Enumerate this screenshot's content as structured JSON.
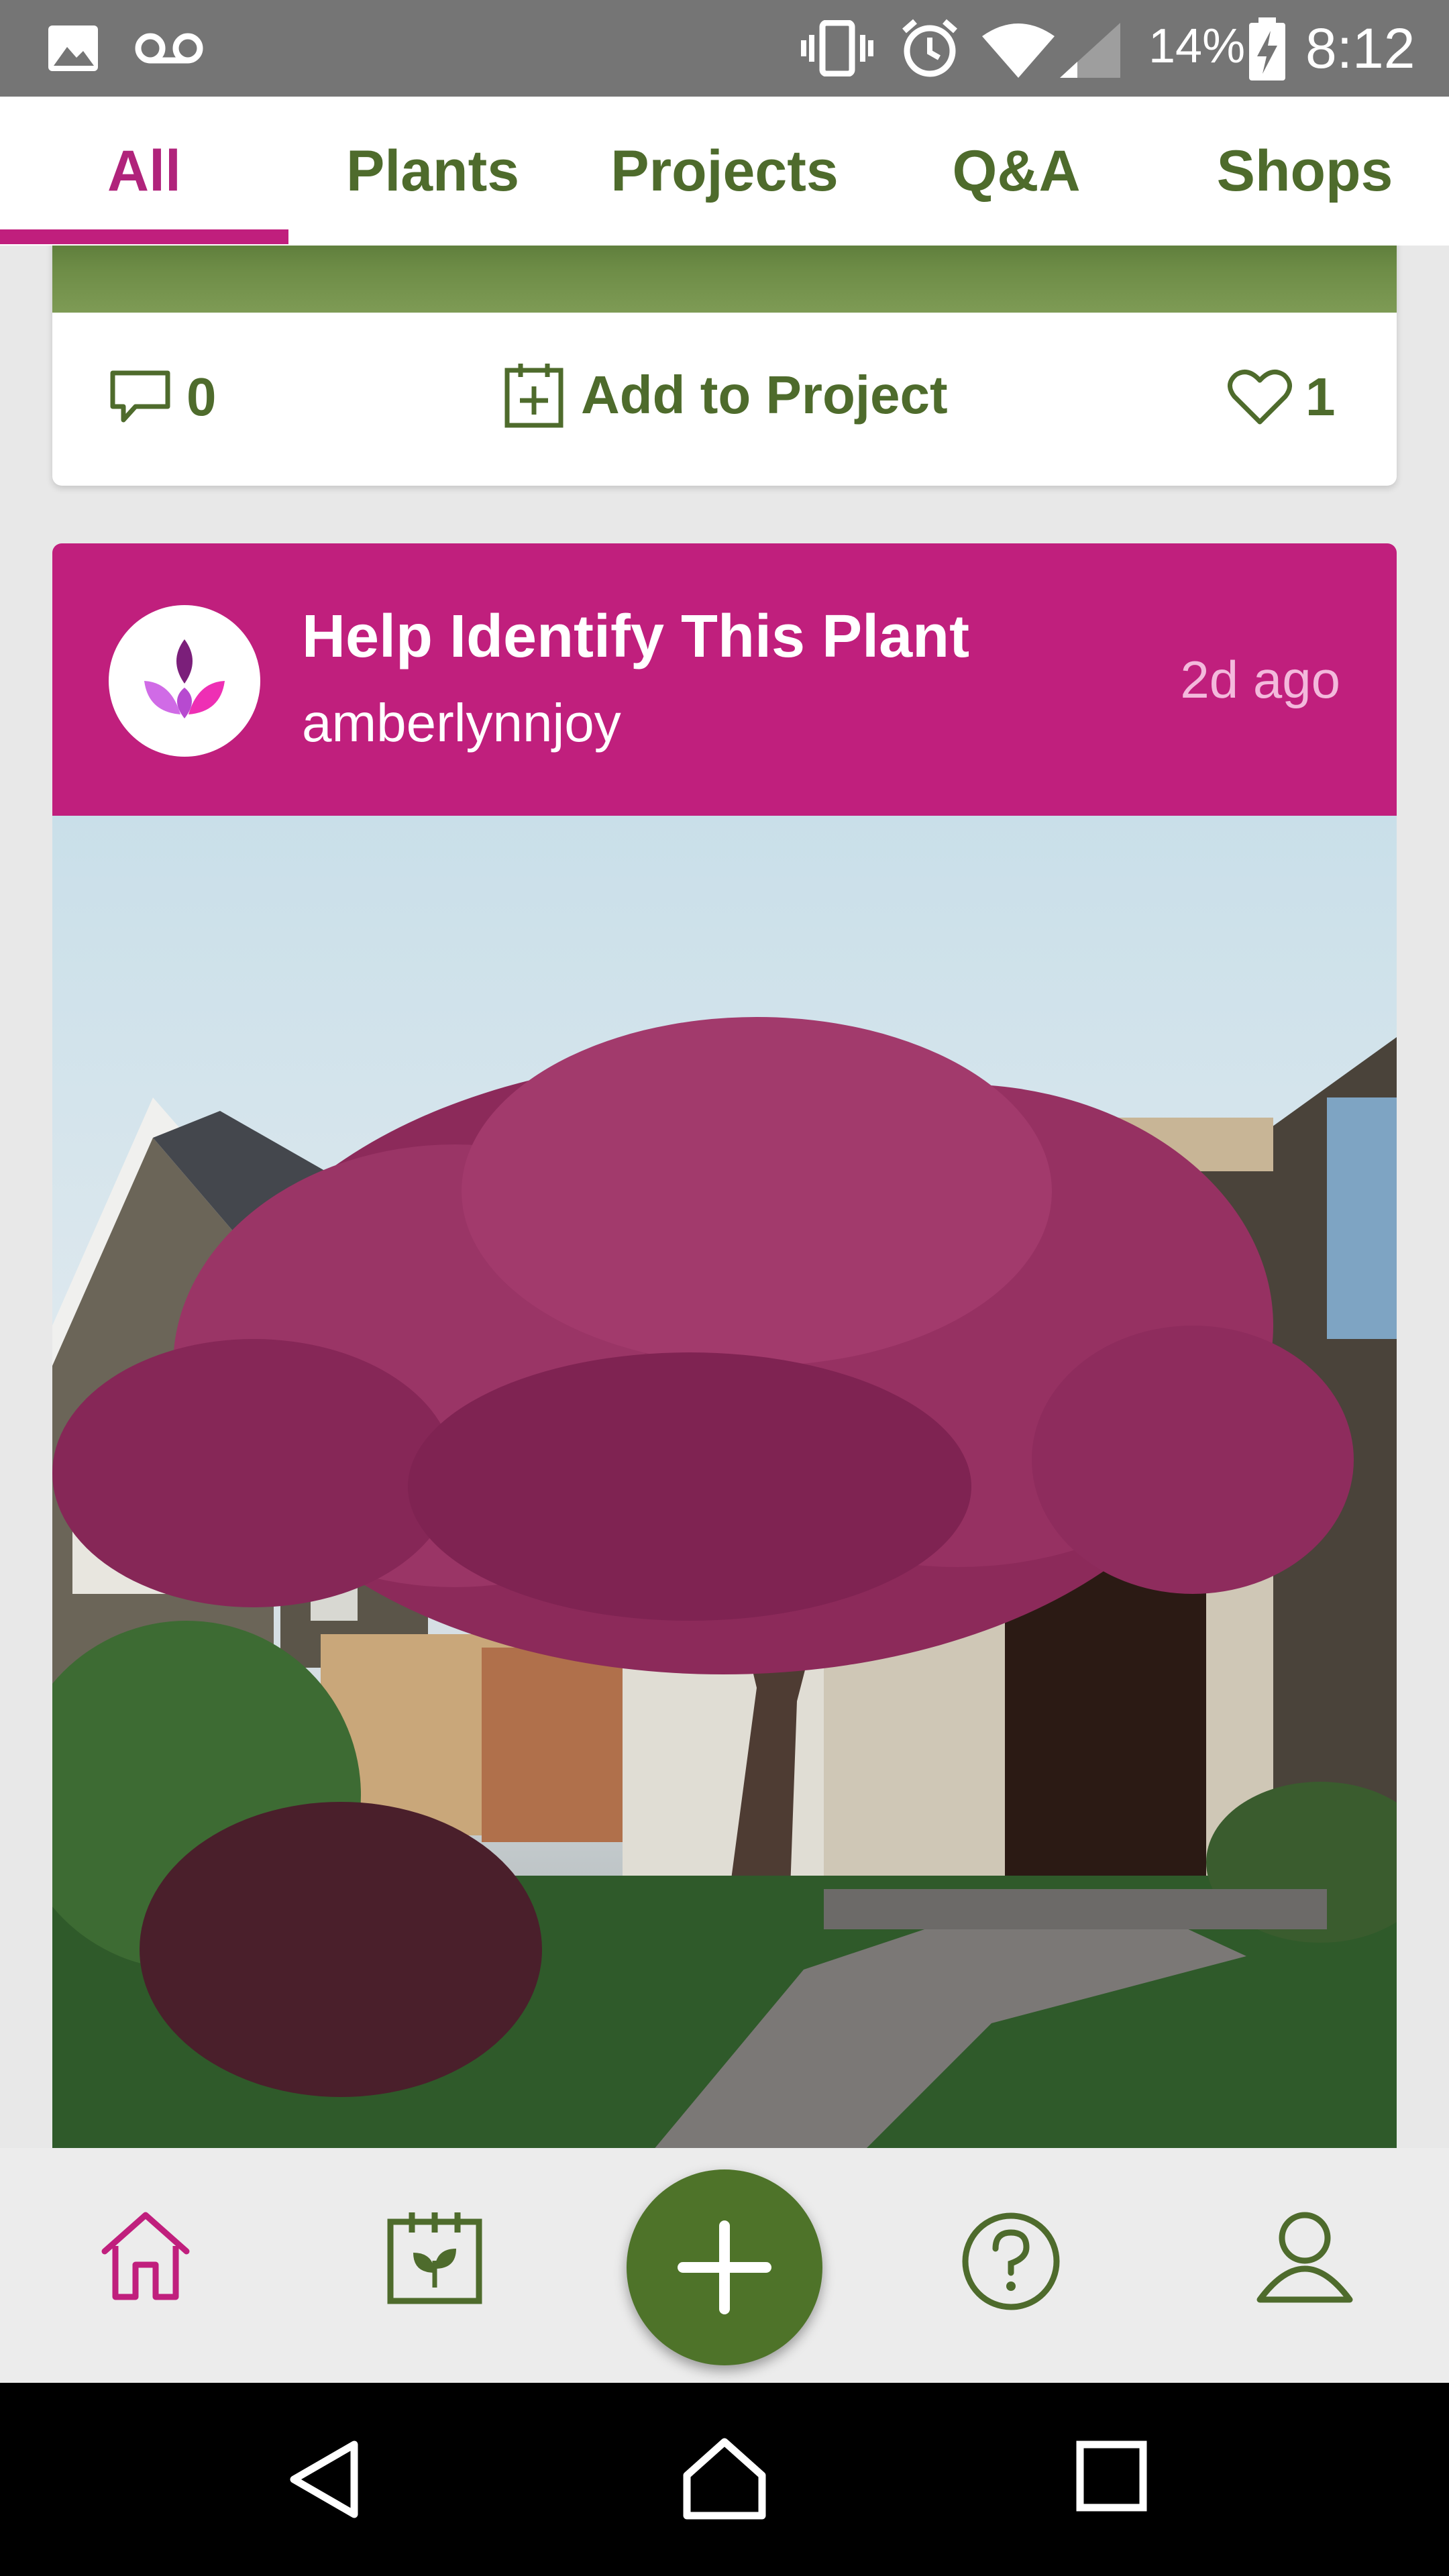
{
  "status_bar": {
    "battery": "14%",
    "time": "8:12",
    "icons": [
      "image-icon",
      "voicemail-icon",
      "vibrate-icon",
      "alarm-icon",
      "wifi-icon",
      "signal-icon",
      "battery-charging-icon"
    ]
  },
  "tabs": [
    {
      "label": "All",
      "active": true
    },
    {
      "label": "Plants"
    },
    {
      "label": "Projects"
    },
    {
      "label": "Q&A"
    },
    {
      "label": "Shops"
    }
  ],
  "colors": {
    "brand_magenta": "#c01f7d",
    "brand_green": "#4e6b2c"
  },
  "feed": {
    "previous_card": {
      "comments": "0",
      "add_to_project": "Add to Project",
      "likes": "1"
    },
    "post": {
      "title": "Help Identify This Plant",
      "author": "amberlynnjoy",
      "time_ago": "2d ago"
    }
  },
  "bottom_nav": {
    "items": [
      "home-icon",
      "garden-journal-icon",
      "add-icon",
      "question-icon",
      "profile-icon"
    ],
    "active": "home-icon"
  },
  "system_nav": [
    "back-icon",
    "home-icon",
    "recents-icon"
  ]
}
